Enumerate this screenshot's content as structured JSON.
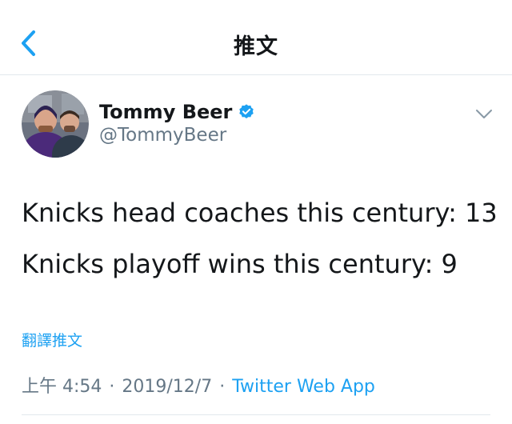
{
  "header": {
    "title": "推文",
    "back_icon": "chevron-left-icon",
    "accent_color": "#1da1f2"
  },
  "author": {
    "display_name": "Tommy Beer",
    "handle": "@TommyBeer",
    "verified": true,
    "verified_color": "#1da1f2",
    "menu_icon": "chevron-down-icon"
  },
  "tweet": {
    "lines": [
      "Knicks head coaches this century: 13",
      "Knicks playoff wins this century: 9"
    ],
    "translate_label": "翻譯推文"
  },
  "meta": {
    "time": "上午 4:54",
    "separator": "·",
    "date": "2019/12/7",
    "source": "Twitter Web App"
  }
}
